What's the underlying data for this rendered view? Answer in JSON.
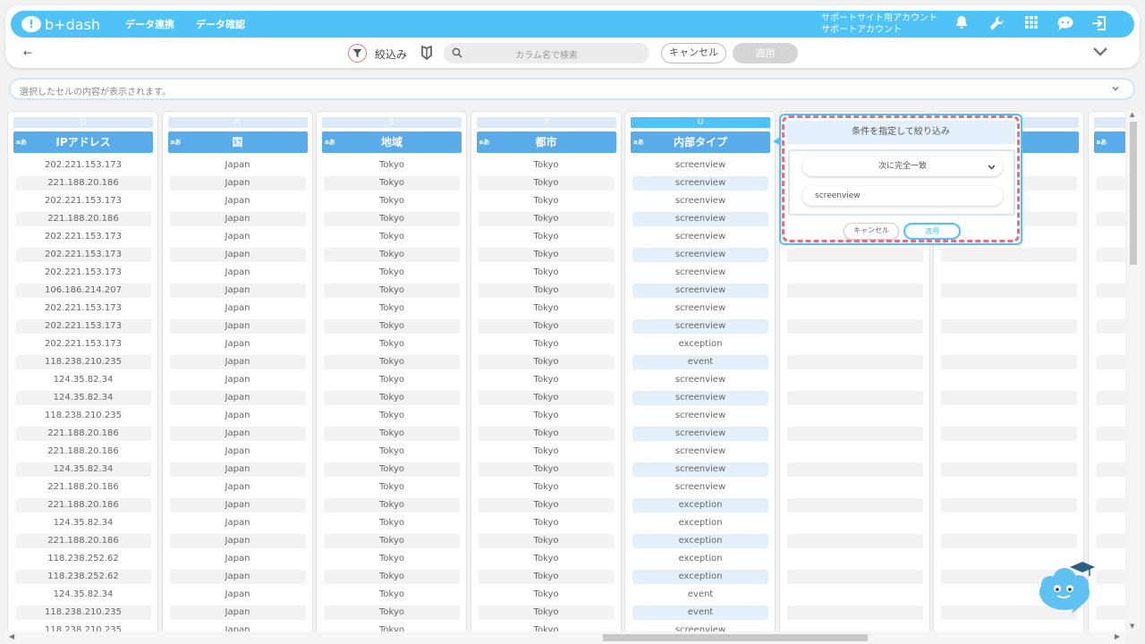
{
  "brand": {
    "logo_text": "b+dash"
  },
  "nav": {
    "links": [
      "データ連携",
      "データ確認"
    ]
  },
  "account": {
    "line1": "サポートサイト用アカウント",
    "line2": "サポートアカウント"
  },
  "icons": {
    "bell": "bell-icon",
    "wrench": "wrench-icon",
    "apps": "grid-icon",
    "chat": "chat-icon",
    "logout": "logout-icon"
  },
  "toolbar": {
    "back": "←",
    "filter_label": "絞込み",
    "search_placeholder": "カラム名で検索",
    "cancel_label": "キャンセル",
    "apply_label": "適用"
  },
  "cellbar": {
    "placeholder": "選択したセルの内容が表示されます。"
  },
  "type_tag": "aあ",
  "columns": [
    {
      "letter": "Q",
      "header": "IPアドレス",
      "blue": false,
      "values": [
        "202.221.153.173",
        "221.188.20.186",
        "202.221.153.173",
        "221.188.20.186",
        "202.221.153.173",
        "202.221.153.173",
        "202.221.153.173",
        "106.186.214.207",
        "202.221.153.173",
        "202.221.153.173",
        "202.221.153.173",
        "118.238.210.235",
        "124.35.82.34",
        "124.35.82.34",
        "118.238.210.235",
        "221.188.20.186",
        "221.188.20.186",
        "124.35.82.34",
        "221.188.20.186",
        "221.188.20.186",
        "124.35.82.34",
        "221.188.20.186",
        "118.238.252.62",
        "118.238.252.62",
        "124.35.82.34",
        "118.238.210.235",
        "118.238.210.235"
      ]
    },
    {
      "letter": "R",
      "header": "国",
      "blue": false,
      "values": [
        "Japan",
        "Japan",
        "Japan",
        "Japan",
        "Japan",
        "Japan",
        "Japan",
        "Japan",
        "Japan",
        "Japan",
        "Japan",
        "Japan",
        "Japan",
        "Japan",
        "Japan",
        "Japan",
        "Japan",
        "Japan",
        "Japan",
        "Japan",
        "Japan",
        "Japan",
        "Japan",
        "Japan",
        "Japan",
        "Japan",
        "Japan"
      ]
    },
    {
      "letter": "S",
      "header": "地域",
      "blue": false,
      "values": [
        "Tokyo",
        "Tokyo",
        "Tokyo",
        "Tokyo",
        "Tokyo",
        "Tokyo",
        "Tokyo",
        "Tokyo",
        "Tokyo",
        "Tokyo",
        "Tokyo",
        "Tokyo",
        "Tokyo",
        "Tokyo",
        "Tokyo",
        "Tokyo",
        "Tokyo",
        "Tokyo",
        "Tokyo",
        "Tokyo",
        "Tokyo",
        "Tokyo",
        "Tokyo",
        "Tokyo",
        "Tokyo",
        "Tokyo",
        "Tokyo"
      ]
    },
    {
      "letter": "T",
      "header": "都市",
      "blue": false,
      "values": [
        "Tokyo",
        "Tokyo",
        "Tokyo",
        "Tokyo",
        "Tokyo",
        "Tokyo",
        "Tokyo",
        "Tokyo",
        "Tokyo",
        "Tokyo",
        "Tokyo",
        "Tokyo",
        "Tokyo",
        "Tokyo",
        "Tokyo",
        "Tokyo",
        "Tokyo",
        "Tokyo",
        "Tokyo",
        "Tokyo",
        "Tokyo",
        "Tokyo",
        "Tokyo",
        "Tokyo",
        "Tokyo",
        "Tokyo",
        "Tokyo"
      ]
    },
    {
      "letter": "U",
      "header": "内部タイプ",
      "blue": true,
      "active": true,
      "values": [
        "screenview",
        "screenview",
        "screenview",
        "screenview",
        "screenview",
        "screenview",
        "screenview",
        "screenview",
        "screenview",
        "screenview",
        "exception",
        "event",
        "screenview",
        "screenview",
        "screenview",
        "screenview",
        "screenview",
        "screenview",
        "screenview",
        "exception",
        "exception",
        "exception",
        "exception",
        "exception",
        "event",
        "event",
        "screenview"
      ]
    },
    {
      "letter": "",
      "header": "",
      "blue": false,
      "values": []
    },
    {
      "letter": "",
      "header": "ン名",
      "blue": false,
      "values": []
    },
    {
      "letter": "",
      "header": "",
      "blue": false,
      "values": []
    }
  ],
  "popup": {
    "title": "条件を指定して絞り込み",
    "operator": "次に完全一致",
    "value": "screenview",
    "cancel_label": "キャンセル",
    "apply_label": "適用"
  },
  "scroll": {
    "up": "▲",
    "down": "▼",
    "left": "◀",
    "right": "▶"
  },
  "colors": {
    "accent": "#4fc3f7",
    "header_blue": "#5aabea",
    "highlight": "#f06a7a"
  }
}
